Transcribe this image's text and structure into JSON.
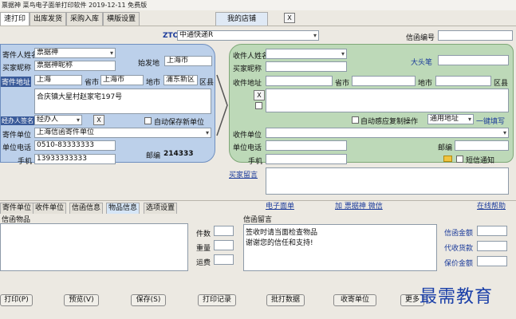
{
  "window": {
    "title": "票据神 菜鸟电子面单打印软件 2019-12-11 免费版"
  },
  "tabs": [
    {
      "label": "速打印"
    },
    {
      "label": "出库发货"
    },
    {
      "label": "采购入库"
    },
    {
      "label": "横版设置"
    }
  ],
  "my_shop": "我的店铺",
  "x_label": "X",
  "carrier": {
    "code": "ZTO",
    "value": "中通快递R"
  },
  "tracking_no_label": "信函编号",
  "sender": {
    "name_label": "寄件人姓名",
    "name_value": "票据神",
    "buyer_nick_label": "买家昵称",
    "buyer_nick_value": "票据神昵称",
    "origin_label": "始发地",
    "origin_value": "上海市",
    "address_label": "寄件地址",
    "province_value": "上海",
    "province_label": "省市",
    "city_value": "上海市",
    "city_label": "地市",
    "district_value": "浦东新区",
    "district_label": "区县",
    "address_detail": "合庆镇大星村赵家宅197号",
    "auto_save_label": "自动保存新单位",
    "handler_label": "经办人签名",
    "handler_value": "经办人",
    "unit_label": "寄件单位",
    "unit_value": "上海信函寄件单位",
    "phone_label": "单位电话",
    "phone_value": "0510-83333333",
    "mobile_label": "手机",
    "mobile_value": "13933333333",
    "postcode_label": "邮编",
    "postcode_value": "214333"
  },
  "receiver": {
    "name_label": "收件人姓名",
    "buyer_nick_label": "买家昵称",
    "big_head_label": "大头笔",
    "address_label": "收件地址",
    "province_label": "省市",
    "city_label": "地市",
    "district_label": "区县",
    "auto_copy_label": "自动感应复制操作",
    "general_address": "通用地址",
    "one_key_label": "一键填写",
    "unit_label": "收件单位",
    "phone_label": "单位电话",
    "postcode_label": "邮编",
    "mobile_label": "手机",
    "sms_label": "短信通知"
  },
  "buyer_message_link": "买家留言",
  "lower_tabs": [
    {
      "label": "寄件单位"
    },
    {
      "label": "收件单位"
    },
    {
      "label": "信函信息"
    },
    {
      "label": "物品信息"
    },
    {
      "label": "选项设置"
    }
  ],
  "links": {
    "e_waybill": "电子面单",
    "add_picker": "加 票据神 微信",
    "online_help": "在线帮助"
  },
  "goods": {
    "title": "信函物品",
    "count_label": "件数",
    "weight_label": "重量",
    "freight_label": "运费"
  },
  "message": {
    "title": "信函留言",
    "line1": "签收时请当面检查物品",
    "line2": "谢谢您的信任和支持!"
  },
  "amounts": {
    "letter_amount": "信函金额",
    "cod_amount": "代收货款",
    "insured_amount": "保价金额"
  },
  "bottom_buttons": [
    {
      "label": "打印(P)"
    },
    {
      "label": "预览(V)"
    },
    {
      "label": "保存(S)"
    },
    {
      "label": "打印记录"
    },
    {
      "label": "批打数据"
    },
    {
      "label": "收寄单位"
    },
    {
      "label": "更多"
    }
  ],
  "watermark": "最需教育"
}
